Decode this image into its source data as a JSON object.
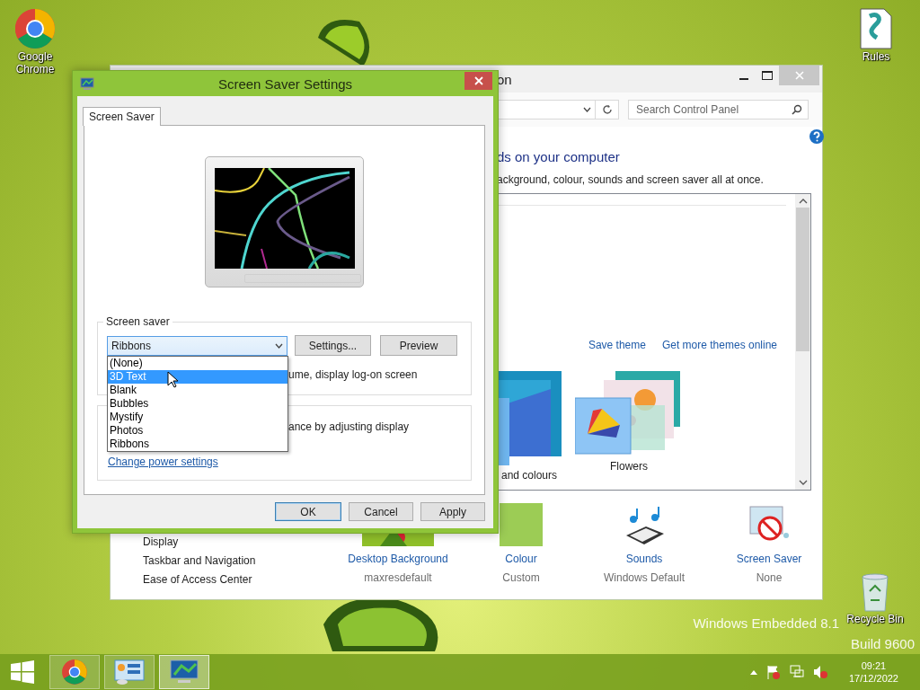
{
  "desktop": {
    "icons": [
      {
        "kind": "chrome",
        "label": "Google Chrome"
      },
      {
        "kind": "rules",
        "label": "Rules"
      },
      {
        "kind": "recycle",
        "label": "Recycle Bin"
      }
    ],
    "os_edition": [
      "Windows Embedded 8.1",
      "Build 9600"
    ]
  },
  "control_panel": {
    "title": "on",
    "search": {
      "placeholder": "Search Control Panel"
    },
    "heading": "ds on your computer",
    "description": "ackground, colour, sounds and screen saver all at once.",
    "theme_links": [
      "Save theme",
      "Get more themes online"
    ],
    "themes": [
      {
        "kind": "blue",
        "label": "and colours"
      },
      {
        "kind": "flowers",
        "label": "Flowers"
      }
    ],
    "sidebar": [
      "Display",
      "Taskbar and Navigation",
      "Ease of Access Center"
    ],
    "settings": [
      {
        "kind": "background",
        "label": "Desktop Background",
        "value": "maxresdefault"
      },
      {
        "kind": "colour",
        "label": "Colour",
        "value": "Custom"
      },
      {
        "kind": "sounds",
        "label": "Sounds",
        "value": "Windows Default"
      },
      {
        "kind": "screensaver",
        "label": "Screen Saver",
        "value": "None"
      }
    ]
  },
  "dialog": {
    "title": "Screen Saver Settings",
    "tabs": [
      {
        "label": "Screen Saver",
        "selected": true
      }
    ],
    "screen_saver": {
      "legend": "Screen saver",
      "value": "Ribbons",
      "options": [
        {
          "label": "(None)",
          "highlighted": false
        },
        {
          "label": "3D Text",
          "highlighted": true
        },
        {
          "label": "Blank",
          "highlighted": false
        },
        {
          "label": "Bubbles",
          "highlighted": false
        },
        {
          "label": "Mystify",
          "highlighted": false
        },
        {
          "label": "Photos",
          "highlighted": false
        },
        {
          "label": "Ribbons",
          "highlighted": false
        }
      ],
      "buttons": [
        "Settings...",
        "Preview"
      ],
      "resume_text": "ume, display log-on screen"
    },
    "power": {
      "text": "ance by adjusting display",
      "link": "Change power settings"
    },
    "buttons": [
      {
        "label": "OK",
        "default": true
      },
      {
        "label": "Cancel",
        "default": false
      },
      {
        "label": "Apply",
        "default": false
      }
    ]
  },
  "taskbar": {
    "apps": [
      {
        "kind": "chrome",
        "active": false
      },
      {
        "kind": "control-panel",
        "active": false
      },
      {
        "kind": "screensaver",
        "active": true
      }
    ],
    "clock": {
      "time": "09:21",
      "date": "17/12/2022"
    }
  }
}
